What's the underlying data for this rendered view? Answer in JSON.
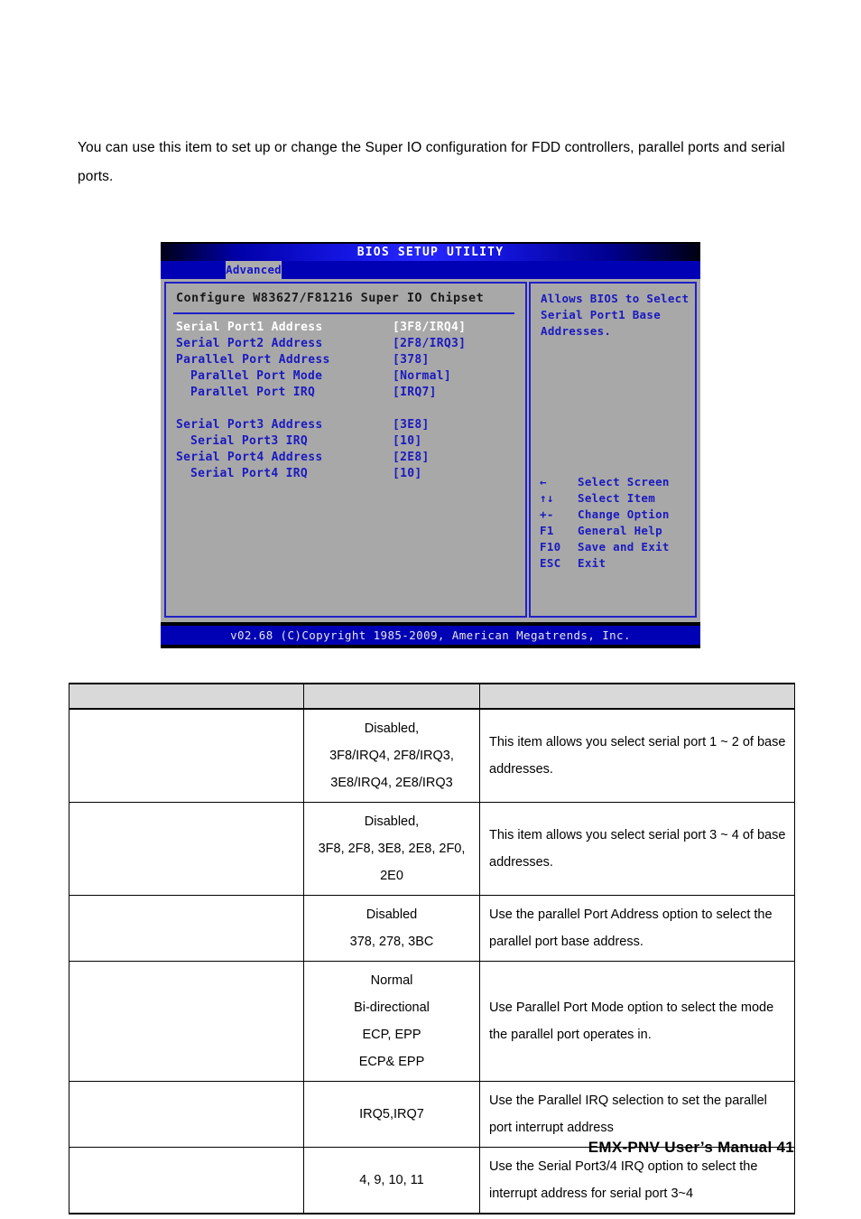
{
  "intro_paragraph": "You can use this item to set up or change the Super IO configuration for FDD controllers, parallel ports and serial ports.",
  "bios": {
    "title": "BIOS SETUP UTILITY",
    "active_tab": "Advanced",
    "section_heading": "Configure W83627/F81216 Super IO Chipset",
    "items": [
      {
        "label": "Serial Port1 Address",
        "value": "[3F8/IRQ4]",
        "selected": true,
        "indent": false
      },
      {
        "label": "Serial Port2 Address",
        "value": "[2F8/IRQ3]",
        "selected": false,
        "indent": false
      },
      {
        "label": "Parallel Port Address",
        "value": "[378]",
        "selected": false,
        "indent": false
      },
      {
        "label": "Parallel Port Mode",
        "value": "[Normal]",
        "selected": false,
        "indent": true
      },
      {
        "label": "Parallel Port IRQ",
        "value": "[IRQ7]",
        "selected": false,
        "indent": true
      },
      {
        "label": "",
        "value": "",
        "selected": false,
        "indent": false
      },
      {
        "label": "Serial Port3 Address",
        "value": "[3E8]",
        "selected": false,
        "indent": false
      },
      {
        "label": "Serial Port3 IRQ",
        "value": "[10]",
        "selected": false,
        "indent": true
      },
      {
        "label": "Serial Port4 Address",
        "value": "[2E8]",
        "selected": false,
        "indent": false
      },
      {
        "label": "Serial Port4 IRQ",
        "value": "[10]",
        "selected": false,
        "indent": true
      }
    ],
    "help_text": "Allows BIOS to Select Serial Port1 Base Addresses.",
    "legend": [
      {
        "key": "←",
        "desc": "Select Screen"
      },
      {
        "key": "↑↓",
        "desc": "Select Item"
      },
      {
        "key": "+-",
        "desc": "Change Option"
      },
      {
        "key": "F1",
        "desc": "General Help"
      },
      {
        "key": "F10",
        "desc": "Save and Exit"
      },
      {
        "key": "ESC",
        "desc": "Exit"
      }
    ],
    "footer": "v02.68 (C)Copyright 1985-2009, American Megatrends, Inc."
  },
  "spec_table": {
    "headers": [
      "",
      "",
      ""
    ],
    "rows": [
      {
        "name": "",
        "options": [
          "Disabled,",
          "3F8/IRQ4, 2F8/IRQ3,",
          "3E8/IRQ4, 2E8/IRQ3"
        ],
        "description": "This item allows you select serial port 1 ~ 2 of base addresses."
      },
      {
        "name": "",
        "options": [
          "Disabled,",
          "3F8, 2F8, 3E8, 2E8, 2F0,",
          "2E0"
        ],
        "description": "This item allows you select serial port 3 ~ 4 of base addresses."
      },
      {
        "name": "",
        "options": [
          "Disabled",
          "378, 278, 3BC"
        ],
        "description": "Use the parallel Port Address option to select the parallel port base address."
      },
      {
        "name": "",
        "options": [
          "Normal",
          "Bi-directional",
          "ECP, EPP",
          "ECP& EPP"
        ],
        "description": "Use Parallel Port Mode option to select the mode the parallel port operates in."
      },
      {
        "name": "",
        "options": [
          "IRQ5,IRQ7"
        ],
        "description": "Use the Parallel IRQ selection to set the parallel port interrupt address"
      },
      {
        "name": "",
        "options": [
          "4, 9, 10, 11"
        ],
        "description": "Use the Serial Port3/4 IRQ option to select the interrupt address for serial port 3~4"
      }
    ]
  },
  "page_footer": "EMX-PNV User’s Manual 41",
  "colors": {
    "bios_blue": "#0000b4",
    "bios_text_blue": "#1a1ac0",
    "bios_panel_gray": "#a8a8a8",
    "table_header_gray": "#d9d9d9"
  }
}
